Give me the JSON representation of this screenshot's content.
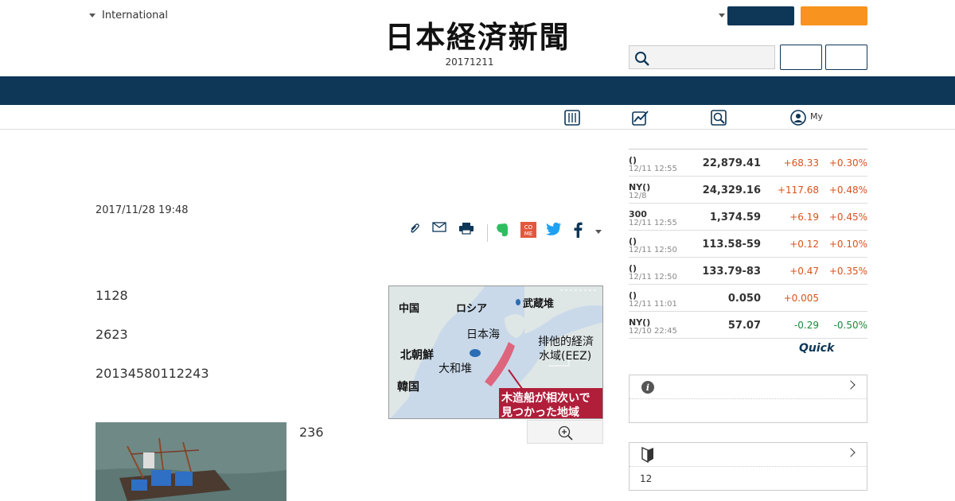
{
  "header": {
    "international_label": "International",
    "logo_text": "日本経済新聞",
    "date": "20171211"
  },
  "subnav": {
    "my_label": "My"
  },
  "article": {
    "published": "2017/11/28 19:48",
    "paragraphs": [
      "1128",
      "2623",
      "20134580112243"
    ],
    "photo_caption": "236",
    "map": {
      "labels": {
        "china": "中国",
        "russia": "ロシア",
        "musashi": "武蔵堆",
        "sea_of_japan": "日本海",
        "eez": "排他的経済",
        "eez2": "水域(EEZ)",
        "north_korea": "北朝鮮",
        "yamato": "大和堆",
        "korea": "韓国",
        "caption1": "木造船が相次いで",
        "caption2": "見つかった地域"
      }
    }
  },
  "markets": {
    "rows": [
      {
        "name": "()",
        "time": "12/11 12:55",
        "value": "22,879.41",
        "change": "+68.33",
        "pct": "+0.30%",
        "dir": "up"
      },
      {
        "name": "NY()",
        "time": "12/8",
        "value": "24,329.16",
        "change": "+117.68",
        "pct": "+0.48%",
        "dir": "up"
      },
      {
        "name": "300",
        "time": "12/11 12:55",
        "value": "1,374.59",
        "change": "+6.19",
        "pct": "+0.45%",
        "dir": "up"
      },
      {
        "name": "()",
        "time": "12/11 12:50",
        "value": "113.58-59",
        "change": "+0.12",
        "pct": "+0.10%",
        "dir": "up"
      },
      {
        "name": "()",
        "time": "12/11 12:50",
        "value": "133.79-83",
        "change": "+0.47",
        "pct": "+0.35%",
        "dir": "up"
      },
      {
        "name": "()",
        "time": "12/11 11:01",
        "value": "0.050",
        "change": "+0.005",
        "pct": "",
        "dir": "up"
      },
      {
        "name": "NY()",
        "time": "12/10 22:45",
        "value": "57.07",
        "change": "-0.29",
        "pct": "-0.50%",
        "dir": "dn"
      }
    ],
    "quick_label": "Quick"
  },
  "box2": {
    "body": "12"
  },
  "colors": {
    "navy": "#0d3657",
    "orange": "#f7931e",
    "up": "#d9531e",
    "down": "#1a8a3a"
  }
}
